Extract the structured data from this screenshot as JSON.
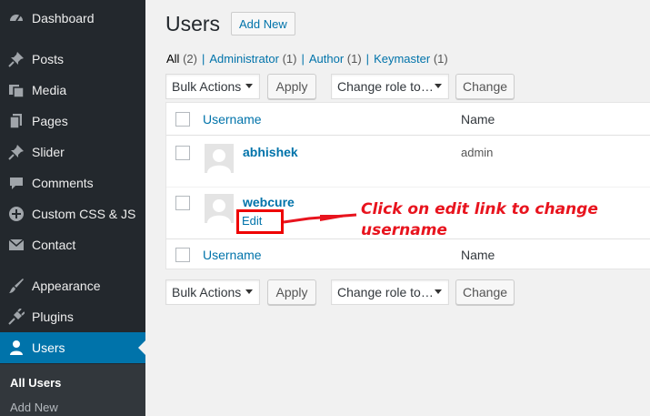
{
  "sidebar": {
    "items": [
      {
        "label": "Dashboard",
        "icon": "dashboard-icon"
      },
      {
        "label": "Posts",
        "icon": "pin-icon"
      },
      {
        "label": "Media",
        "icon": "media-icon"
      },
      {
        "label": "Pages",
        "icon": "pages-icon"
      },
      {
        "label": "Slider",
        "icon": "pin-icon"
      },
      {
        "label": "Comments",
        "icon": "comment-icon"
      },
      {
        "label": "Custom CSS & JS",
        "icon": "plus-circle-icon"
      },
      {
        "label": "Contact",
        "icon": "mail-icon"
      },
      {
        "label": "Appearance",
        "icon": "brush-icon"
      },
      {
        "label": "Plugins",
        "icon": "plug-icon"
      },
      {
        "label": "Users",
        "icon": "user-icon"
      }
    ],
    "active": "Users",
    "submenu": [
      {
        "label": "All Users"
      },
      {
        "label": "Add New"
      }
    ]
  },
  "page": {
    "title": "Users",
    "add_new": "Add New"
  },
  "filters": [
    {
      "label": "All",
      "count": "(2)"
    },
    {
      "label": "Administrator",
      "count": "(1)"
    },
    {
      "label": "Author",
      "count": "(1)"
    },
    {
      "label": "Keymaster",
      "count": "(1)"
    }
  ],
  "filter_separator": "|",
  "bulk": {
    "actions_label": "Bulk Actions",
    "apply_label": "Apply",
    "role_label": "Change role to…",
    "change_label": "Change"
  },
  "table": {
    "columns": {
      "username": "Username",
      "name": "Name"
    },
    "rows": [
      {
        "username": "abhishek",
        "name": "admin"
      },
      {
        "username": "webcure",
        "name": "",
        "action": "Edit"
      }
    ]
  },
  "annotation": {
    "text": "Click on edit link to change username",
    "color": "#e8141e"
  },
  "colors": {
    "accent": "#0073aa",
    "sidebar": "#23282d",
    "highlight": "#e00000"
  }
}
